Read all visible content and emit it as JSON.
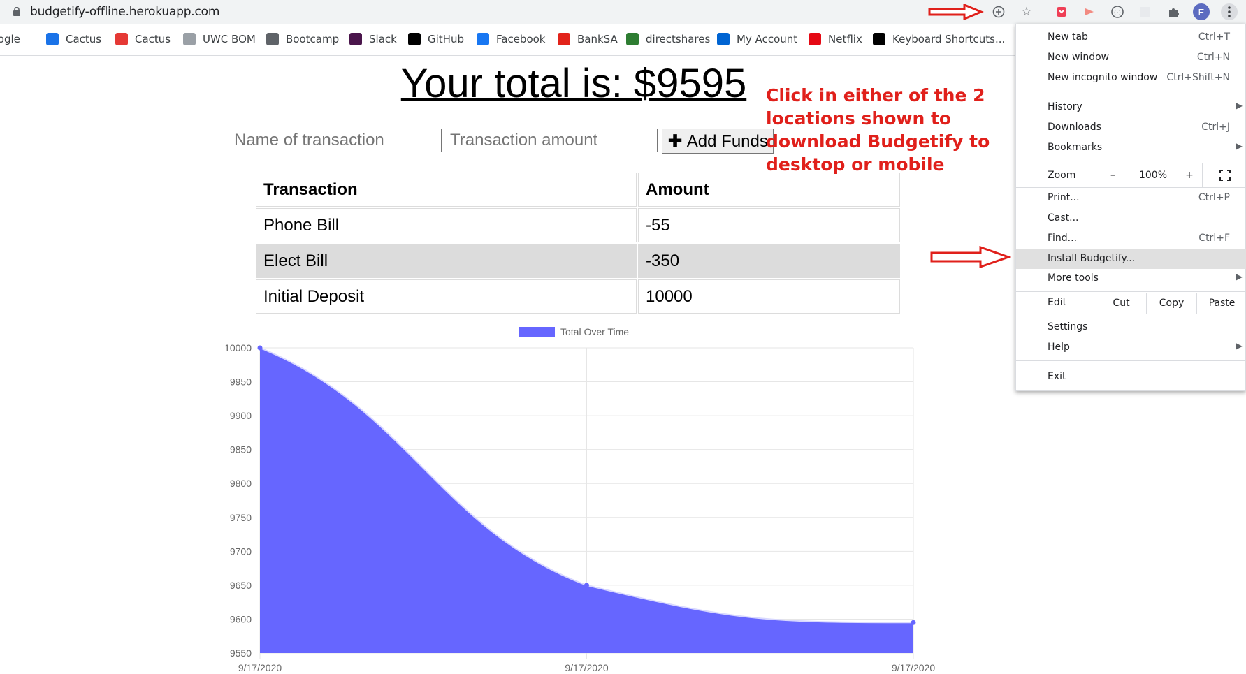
{
  "browser": {
    "url": "budgetify-offline.herokuapp.com",
    "profile_initial": "E",
    "bookmarks": [
      {
        "label": "Google",
        "icon": "google-icon",
        "color": "#4285f4"
      },
      {
        "label": "Cactus",
        "icon": "cactus-icon",
        "color": "#1a73e8"
      },
      {
        "label": "Cactus",
        "icon": "cactus-logo-icon",
        "color": "#e53935"
      },
      {
        "label": "UWC BOM",
        "icon": "disc-icon",
        "color": "#9aa0a6"
      },
      {
        "label": "Bootcamp",
        "icon": "globe-icon",
        "color": "#5f6368"
      },
      {
        "label": "Slack",
        "icon": "slack-icon",
        "color": "#4a154b"
      },
      {
        "label": "GitHub",
        "icon": "github-icon",
        "color": "#000000"
      },
      {
        "label": "Facebook",
        "icon": "facebook-icon",
        "color": "#1877f2"
      },
      {
        "label": "BankSA",
        "icon": "banksa-icon",
        "color": "#e2231a"
      },
      {
        "label": "directshares",
        "icon": "leaf-icon",
        "color": "#2e7d32"
      },
      {
        "label": "My Account",
        "icon": "telstra-icon",
        "color": "#0064d2"
      },
      {
        "label": "Netflix",
        "icon": "netflix-icon",
        "color": "#e50914"
      },
      {
        "label": "Keyboard Shortcuts...",
        "icon": "htg-icon",
        "color": "#000000"
      }
    ]
  },
  "page": {
    "title": "Your total is: $9595",
    "name_placeholder": "Name of transaction",
    "amount_placeholder": "Transaction amount",
    "add_button": "Add Funds",
    "table": {
      "headers": [
        "Transaction",
        "Amount"
      ],
      "rows": [
        {
          "name": "Phone Bill",
          "amount": "-55"
        },
        {
          "name": "Elect Bill",
          "amount": "-350"
        },
        {
          "name": "Initial Deposit",
          "amount": "10000"
        }
      ]
    }
  },
  "annotation": "Click in either of the 2 locations shown to download Budgetify to desktop or mobile",
  "chrome_menu": {
    "new_tab": "New tab",
    "new_tab_sc": "Ctrl+T",
    "new_window": "New window",
    "new_window_sc": "Ctrl+N",
    "incognito": "New incognito window",
    "incognito_sc": "Ctrl+Shift+N",
    "history": "History",
    "downloads": "Downloads",
    "downloads_sc": "Ctrl+J",
    "bookmarks": "Bookmarks",
    "zoom": "Zoom",
    "zoom_minus": "–",
    "zoom_value": "100%",
    "zoom_plus": "+",
    "print": "Print...",
    "print_sc": "Ctrl+P",
    "cast": "Cast...",
    "find": "Find...",
    "find_sc": "Ctrl+F",
    "install": "Install Budgetify...",
    "more_tools": "More tools",
    "edit": "Edit",
    "cut": "Cut",
    "copy": "Copy",
    "paste": "Paste",
    "settings": "Settings",
    "help": "Help",
    "exit": "Exit"
  },
  "colors": {
    "chart_fill": "#6666ff",
    "annotation": "#e0201b",
    "arrow": "#e0201b"
  },
  "chart_data": {
    "type": "area",
    "legend": "Total Over Time",
    "legend_position": "top",
    "x": [
      "9/17/2020",
      "9/17/2020",
      "9/17/2020"
    ],
    "series": [
      {
        "name": "Total Over Time",
        "values": [
          10000,
          9650,
          9595
        ]
      }
    ],
    "yticks": [
      10000,
      9950,
      9900,
      9850,
      9800,
      9750,
      9700,
      9650,
      9600,
      9550
    ],
    "ylim": [
      9550,
      10000
    ],
    "grid": true
  }
}
